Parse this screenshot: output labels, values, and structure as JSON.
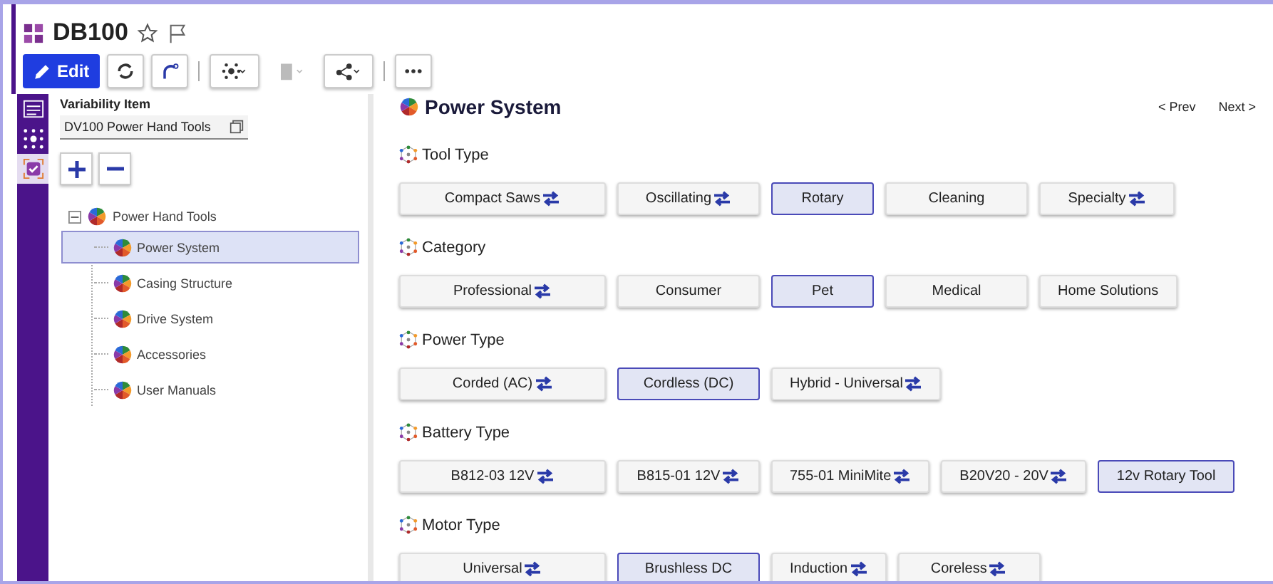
{
  "header": {
    "title": "DB100",
    "toolbar": {
      "edit_label": "Edit",
      "paste_disabled": true
    }
  },
  "sidebar": {
    "rail": [
      {
        "kind": "list",
        "selected": false
      },
      {
        "kind": "network",
        "selected": false
      },
      {
        "kind": "check",
        "selected": true
      }
    ],
    "field_label": "Variability Item",
    "field_value": "DV100 Power Hand Tools",
    "tree": [
      {
        "label": "Power Hand Tools",
        "expanded": true,
        "children": [
          {
            "label": "Power System",
            "selected": true
          },
          {
            "label": "Casing Structure",
            "selected": false
          },
          {
            "label": "Drive System",
            "selected": false
          },
          {
            "label": "Accessories",
            "selected": false
          },
          {
            "label": "User Manuals",
            "selected": false
          }
        ]
      }
    ]
  },
  "main": {
    "title": "Power System",
    "prev": "< Prev",
    "next": "Next >",
    "groups": [
      {
        "title": "Tool Type",
        "options": [
          {
            "label": "Compact Saws",
            "swap": true,
            "selected": false
          },
          {
            "label": "Oscillating",
            "swap": true,
            "selected": false
          },
          {
            "label": "Rotary",
            "swap": false,
            "selected": true
          },
          {
            "label": "Cleaning",
            "swap": false,
            "selected": false
          },
          {
            "label": "Specialty",
            "swap": true,
            "selected": false
          }
        ]
      },
      {
        "title": "Category",
        "options": [
          {
            "label": "Professional",
            "swap": true,
            "selected": false
          },
          {
            "label": "Consumer",
            "swap": false,
            "selected": false
          },
          {
            "label": "Pet",
            "swap": false,
            "selected": true
          },
          {
            "label": "Medical",
            "swap": false,
            "selected": false
          },
          {
            "label": "Home Solutions",
            "swap": false,
            "selected": false
          }
        ]
      },
      {
        "title": "Power Type",
        "options": [
          {
            "label": "Corded (AC)",
            "swap": true,
            "selected": false
          },
          {
            "label": "Cordless (DC)",
            "swap": false,
            "selected": true
          },
          {
            "label": "Hybrid - Universal",
            "swap": true,
            "selected": false
          }
        ]
      },
      {
        "title": "Battery Type",
        "options": [
          {
            "label": "B812-03 12V",
            "swap": true,
            "selected": false
          },
          {
            "label": "B815-01 12V",
            "swap": true,
            "selected": false
          },
          {
            "label": "755-01 MiniMite",
            "swap": true,
            "selected": false
          },
          {
            "label": "B20V20 - 20V",
            "swap": true,
            "selected": false
          },
          {
            "label": "12v Rotary Tool",
            "swap": false,
            "selected": true
          }
        ]
      },
      {
        "title": "Motor Type",
        "options": [
          {
            "label": "Universal",
            "swap": true,
            "selected": false
          },
          {
            "label": "Brushless DC",
            "swap": false,
            "selected": true
          },
          {
            "label": "Induction",
            "swap": true,
            "selected": false
          },
          {
            "label": "Coreless",
            "swap": true,
            "selected": false
          }
        ]
      }
    ]
  }
}
